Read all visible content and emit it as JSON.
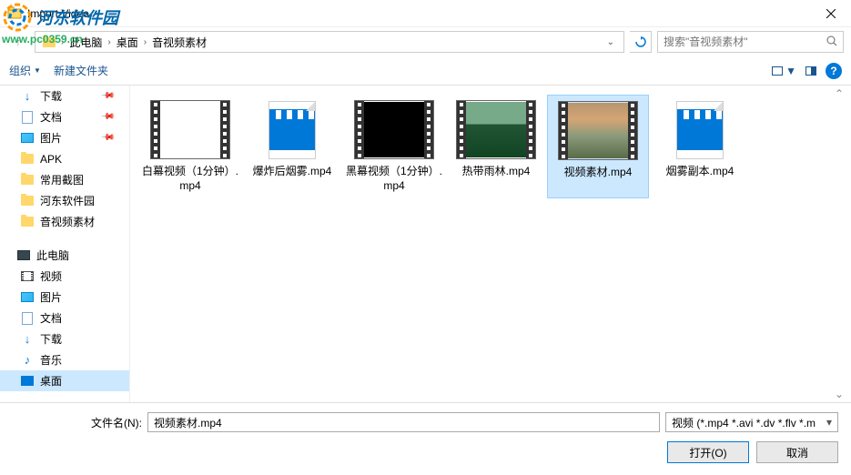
{
  "window": {
    "title": "Import Video"
  },
  "watermark": {
    "text": "河东软件园",
    "url": "www.pc0359.cn"
  },
  "breadcrumb": {
    "seg1": "此电脑",
    "seg2": "桌面",
    "seg3": "音视频素材"
  },
  "search": {
    "placeholder": "搜索\"音视频素材\""
  },
  "toolbar": {
    "organize": "组织",
    "newfolder": "新建文件夹"
  },
  "sidebar": {
    "quick": [
      {
        "label": "下载",
        "icon": "download",
        "pin": true
      },
      {
        "label": "文档",
        "icon": "doc",
        "pin": true
      },
      {
        "label": "图片",
        "icon": "pic",
        "pin": true
      },
      {
        "label": "APK",
        "icon": "folder",
        "pin": false
      },
      {
        "label": "常用截图",
        "icon": "folder",
        "pin": false
      },
      {
        "label": "河东软件园",
        "icon": "folder",
        "pin": false
      },
      {
        "label": "音视频素材",
        "icon": "folder",
        "pin": false
      }
    ],
    "thispc_label": "此电脑",
    "thispc": [
      {
        "label": "视频",
        "icon": "video"
      },
      {
        "label": "图片",
        "icon": "pic"
      },
      {
        "label": "文档",
        "icon": "doc"
      },
      {
        "label": "下载",
        "icon": "download"
      },
      {
        "label": "音乐",
        "icon": "music"
      },
      {
        "label": "桌面",
        "icon": "desktop",
        "selected": true
      }
    ]
  },
  "files": [
    {
      "name": "白幕视频（1分钟）.mp4",
      "thumb": "white"
    },
    {
      "name": "爆炸后烟雾.mp4",
      "thumb": "clap"
    },
    {
      "name": "黑幕视频（1分钟）.mp4",
      "thumb": "black"
    },
    {
      "name": "热带雨林.mp4",
      "thumb": "forest"
    },
    {
      "name": "视频素材.mp4",
      "thumb": "sky",
      "selected": true
    },
    {
      "name": "烟雾副本.mp4",
      "thumb": "clap"
    }
  ],
  "bottom": {
    "fn_label": "文件名(N):",
    "fn_value": "视频素材.mp4",
    "filter": "视频 (*.mp4 *.avi *.dv *.flv *.m",
    "open": "打开(O)",
    "cancel": "取消"
  }
}
